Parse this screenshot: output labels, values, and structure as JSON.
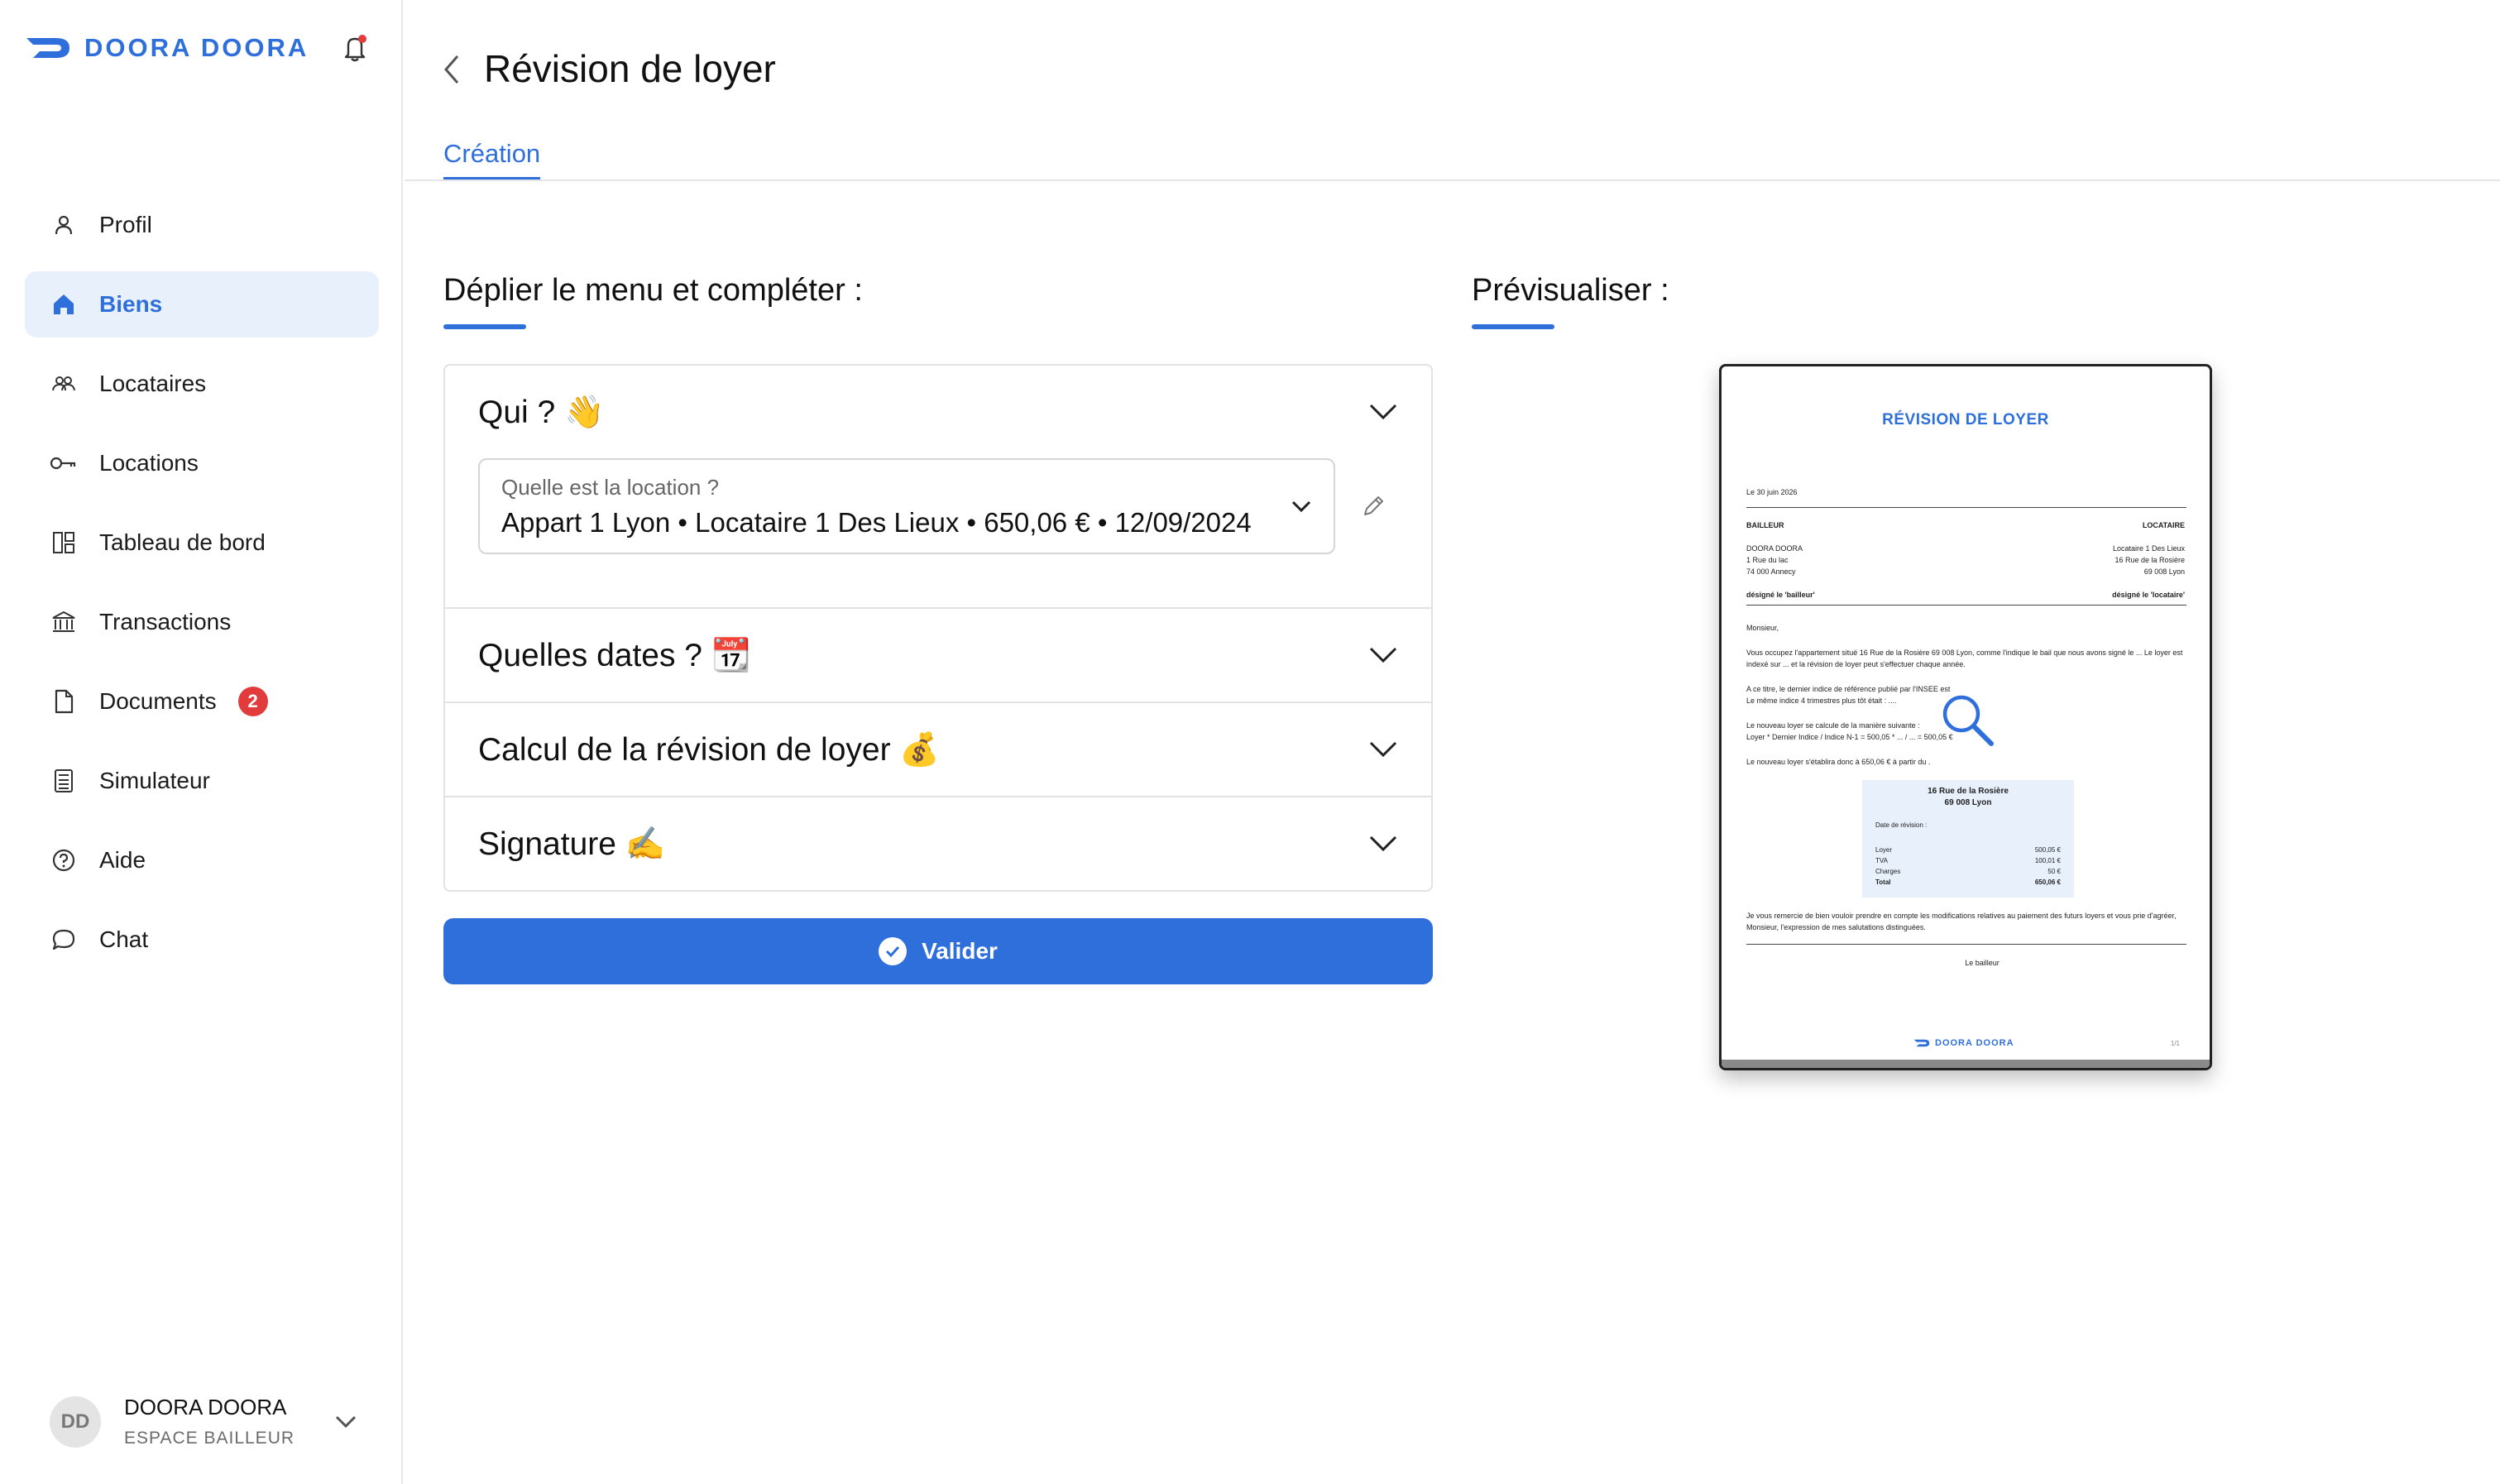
{
  "brand": {
    "name": "DOORA DOORA"
  },
  "sidebar": {
    "items": [
      {
        "label": "Profil",
        "icon": "user-icon"
      },
      {
        "label": "Biens",
        "icon": "home-icon",
        "active": true
      },
      {
        "label": "Locataires",
        "icon": "users-icon"
      },
      {
        "label": "Locations",
        "icon": "key-icon"
      },
      {
        "label": "Tableau de bord",
        "icon": "dashboard-icon"
      },
      {
        "label": "Transactions",
        "icon": "bank-icon"
      },
      {
        "label": "Documents",
        "icon": "document-icon",
        "badge": "2"
      },
      {
        "label": "Simulateur",
        "icon": "calculator-icon"
      },
      {
        "label": "Aide",
        "icon": "help-icon"
      },
      {
        "label": "Chat",
        "icon": "chat-icon"
      }
    ]
  },
  "user": {
    "initials": "DD",
    "name": "DOORA DOORA",
    "role": "ESPACE BAILLEUR"
  },
  "header": {
    "title": "Révision de loyer",
    "tab": "Création"
  },
  "form": {
    "section_title": "Déplier le menu et compléter :",
    "accordion": [
      {
        "title": "Qui ? 👋"
      },
      {
        "title": "Quelles dates ? 📆"
      },
      {
        "title": "Calcul de la révision de loyer 💰"
      },
      {
        "title": "Signature ✍️"
      }
    ],
    "location_select": {
      "label": "Quelle est la location ?",
      "value": "Appart 1 Lyon • Locataire 1 Des Lieux • 650,06 € • 12/09/2024"
    },
    "submit_label": "Valider"
  },
  "preview": {
    "section_title": "Prévisualiser :",
    "doc_title": "RÉVISION DE LOYER",
    "date": "Le 30 juin 2026",
    "bailleur_label": "BAILLEUR",
    "locataire_label": "LOCATAIRE",
    "bailleur_lines": [
      "DOORA DOORA",
      "1 Rue du lac",
      "74 000 Annecy"
    ],
    "locataire_lines": [
      "Locataire 1 Des Lieux",
      "16 Rue de la Rosière",
      "69 008 Lyon"
    ],
    "bailleur_designation": "désigné le 'bailleur'",
    "locataire_designation": "désigné le 'locataire'",
    "salutation": "Monsieur,",
    "para1a": "Vous occupez l'appartement situé 16 Rue de la Rosière 69 008 Lyon, comme l'indique le bail que nous avons signé le ... Le loyer est",
    "para1b": "indexé sur ... et la révision de loyer peut s'effectuer chaque année.",
    "para2a": "A ce titre, le dernier indice de référence publié par l'INSEE est",
    "para2b": "Le même indice 4 trimestres plus tôt était : ....",
    "para3a": "Le nouveau loyer se calcule de la manière suivante :",
    "para3b": "Loyer * Dernier Indice / Indice N-1 = 500,05 * ... / ... = 500,05 €",
    "para4": "Le nouveau loyer s'établira donc à 650,06 € à partir du .",
    "box_line1": "16 Rue de la Rosière",
    "box_line2": "69 008 Lyon",
    "box_date": "Date de révision :",
    "box_rows": [
      {
        "label": "Loyer",
        "value": "500,05 €"
      },
      {
        "label": "TVA",
        "value": "100,01 €"
      },
      {
        "label": "Charges",
        "value": "50 €"
      },
      {
        "label": "Total",
        "value": "650,06 €"
      }
    ],
    "closing_a": "Je vous remercie de bien vouloir prendre en compte les modifications relatives au paiement des futurs loyers et vous prie d'agréer,",
    "closing_b": "Monsieur, l'expression de mes salutations distinguées.",
    "signature": "Le bailleur",
    "footer_brand": "DOORA DOORA",
    "page_number": "1/1"
  },
  "colors": {
    "accent": "#2f6fdc",
    "badge": "#e23b3b",
    "active_bg": "#e8f0fc"
  }
}
